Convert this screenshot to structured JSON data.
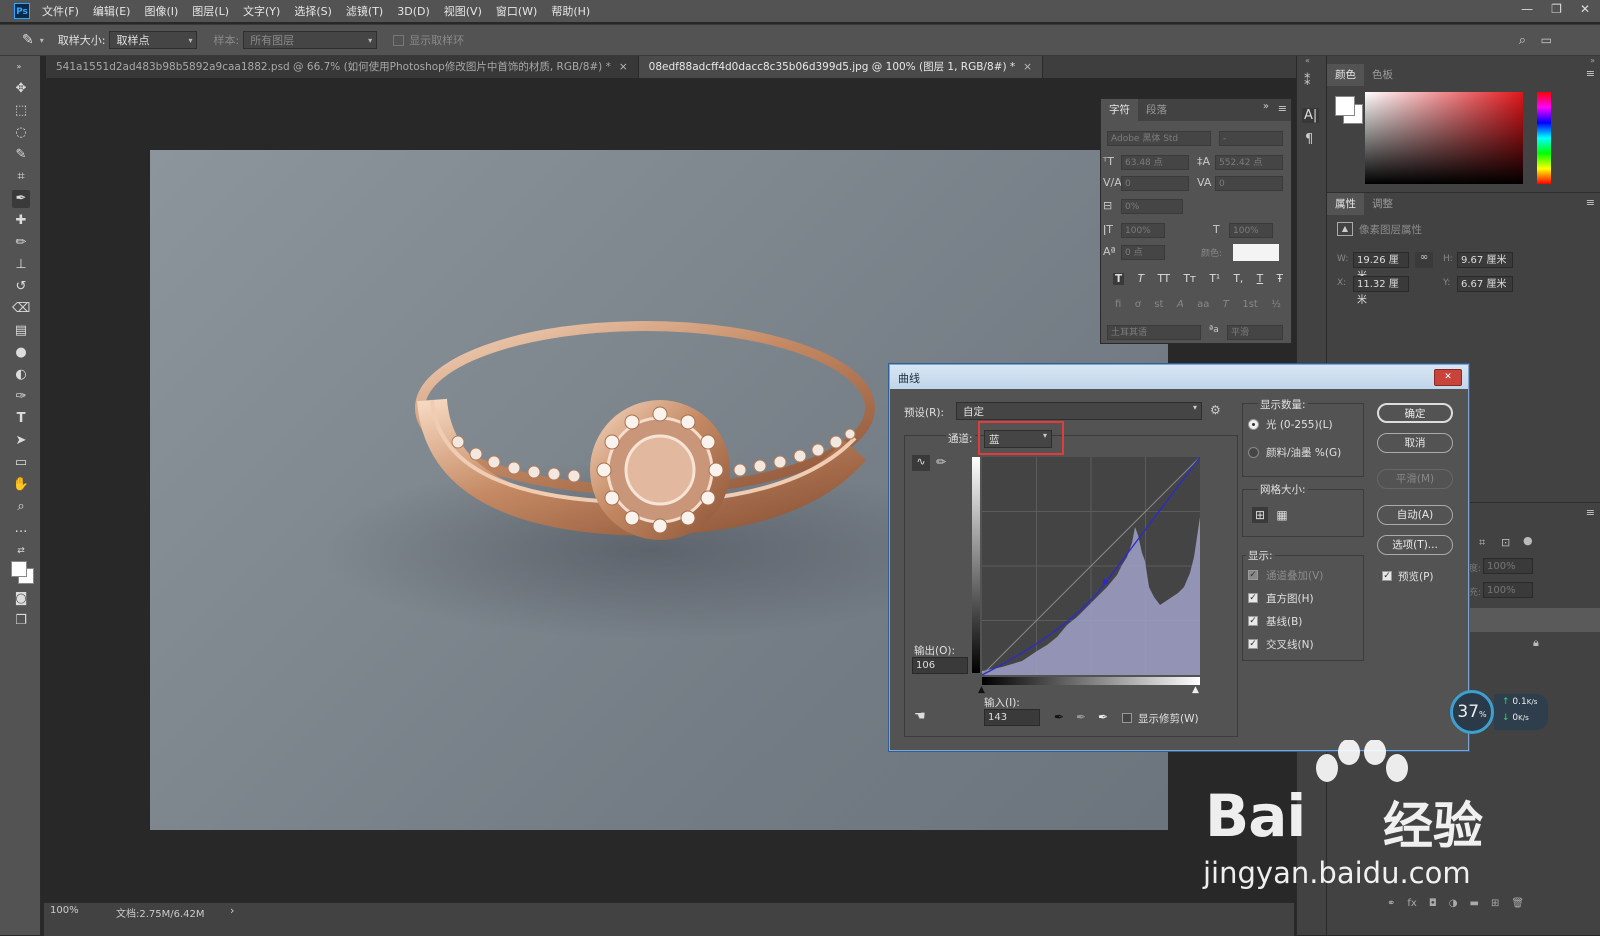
{
  "menu": {
    "logo": "Ps",
    "items": [
      "文件(F)",
      "编辑(E)",
      "图像(I)",
      "图层(L)",
      "文字(Y)",
      "选择(S)",
      "滤镜(T)",
      "3D(D)",
      "视图(V)",
      "窗口(W)",
      "帮助(H)"
    ]
  },
  "options_bar": {
    "sample_size_label": "取样大小:",
    "sample_size_value": "取样点",
    "sample_label": "样本:",
    "sample_value": "所有图层",
    "show_ring_label": "显示取样环"
  },
  "tabs": [
    {
      "label": "541a1551d2ad483b98b5892a9caa1882.psd @ 66.7% (如何使用Photoshop修改图片中首饰的材质, RGB/8#) *",
      "active": false,
      "close": "×"
    },
    {
      "label": "08edf88adcff4d0dacc8c35b06d399d5.jpg @ 100% (图层 1, RGB/8#) *",
      "active": true,
      "close": "×"
    }
  ],
  "status": {
    "zoom": "100%",
    "doc": "文档:2.75M/6.42M",
    "arrow": "›"
  },
  "color_panel": {
    "tab_color": "颜色",
    "tab_swatches": "色板"
  },
  "properties_panel": {
    "tab_props": "属性",
    "tab_adjust": "调整",
    "title": "像素图层属性",
    "w_label": "W:",
    "w_value": "19.26 厘米",
    "h_label": "H:",
    "h_value": "9.67 厘米",
    "x_label": "X:",
    "x_value": "11.32 厘米",
    "y_label": "Y:",
    "y_value": "6.67 厘米",
    "link": "∞"
  },
  "layers_partial": {
    "opacity_label": "度:",
    "opacity": "100%",
    "fill_label": "充:",
    "fill": "100%"
  },
  "char_panel": {
    "tab_char": "字符",
    "tab_para": "段落",
    "font_family": "Adobe 黑体 Std",
    "font_style": "-",
    "size": "63.48 点",
    "leading": "552.42 点",
    "kerning": "0",
    "tracking": "0",
    "scale_pct": "0%",
    "vscale": "100%",
    "hscale": "100%",
    "baseline": "0 点",
    "color_label": "颜色:",
    "style_buttons": [
      "T",
      "T",
      "TT",
      "Tт",
      "T¹",
      "T,",
      "T",
      "Ŧ"
    ],
    "ot_buttons": [
      "fi",
      "ơ",
      "st",
      "A",
      "aa",
      "T",
      "1st",
      "½"
    ],
    "language": "土耳其语",
    "aa_icon": "ªa",
    "aa_value": "平滑"
  },
  "curves": {
    "title": "曲线",
    "close": "✕",
    "preset_label": "预设(R):",
    "preset_value": "自定",
    "channel_label": "通道:",
    "channel_value": "蓝",
    "output_label": "输出(O):",
    "output_value": "106",
    "input_label": "输入(I):",
    "input_value": "143",
    "show_clipping": "显示修剪(W)",
    "ok": "确定",
    "cancel": "取消",
    "smooth": "平滑(M)",
    "auto": "自动(A)",
    "options": "选项(T)...",
    "preview": "预览(P)",
    "display_amount_label": "显示数量:",
    "light_option": "光 (0-255)(L)",
    "pigment_option": "颜料/油墨 %(G)",
    "grid_size_label": "网格大小:",
    "show_label": "显示:",
    "channel_overlays": "通道叠加(V)",
    "histogram": "直方图(H)",
    "baseline": "基线(B)",
    "intersection": "交叉线(N)"
  },
  "net_widget": {
    "percent": "37",
    "percent_unit": "%",
    "up": "0.1",
    "up_unit": "K/s",
    "down": "0",
    "down_unit": "K/s"
  },
  "watermark": {
    "brand": "Bai",
    "brand_cn": "经验",
    "url": "jingyan.baidu.com"
  }
}
